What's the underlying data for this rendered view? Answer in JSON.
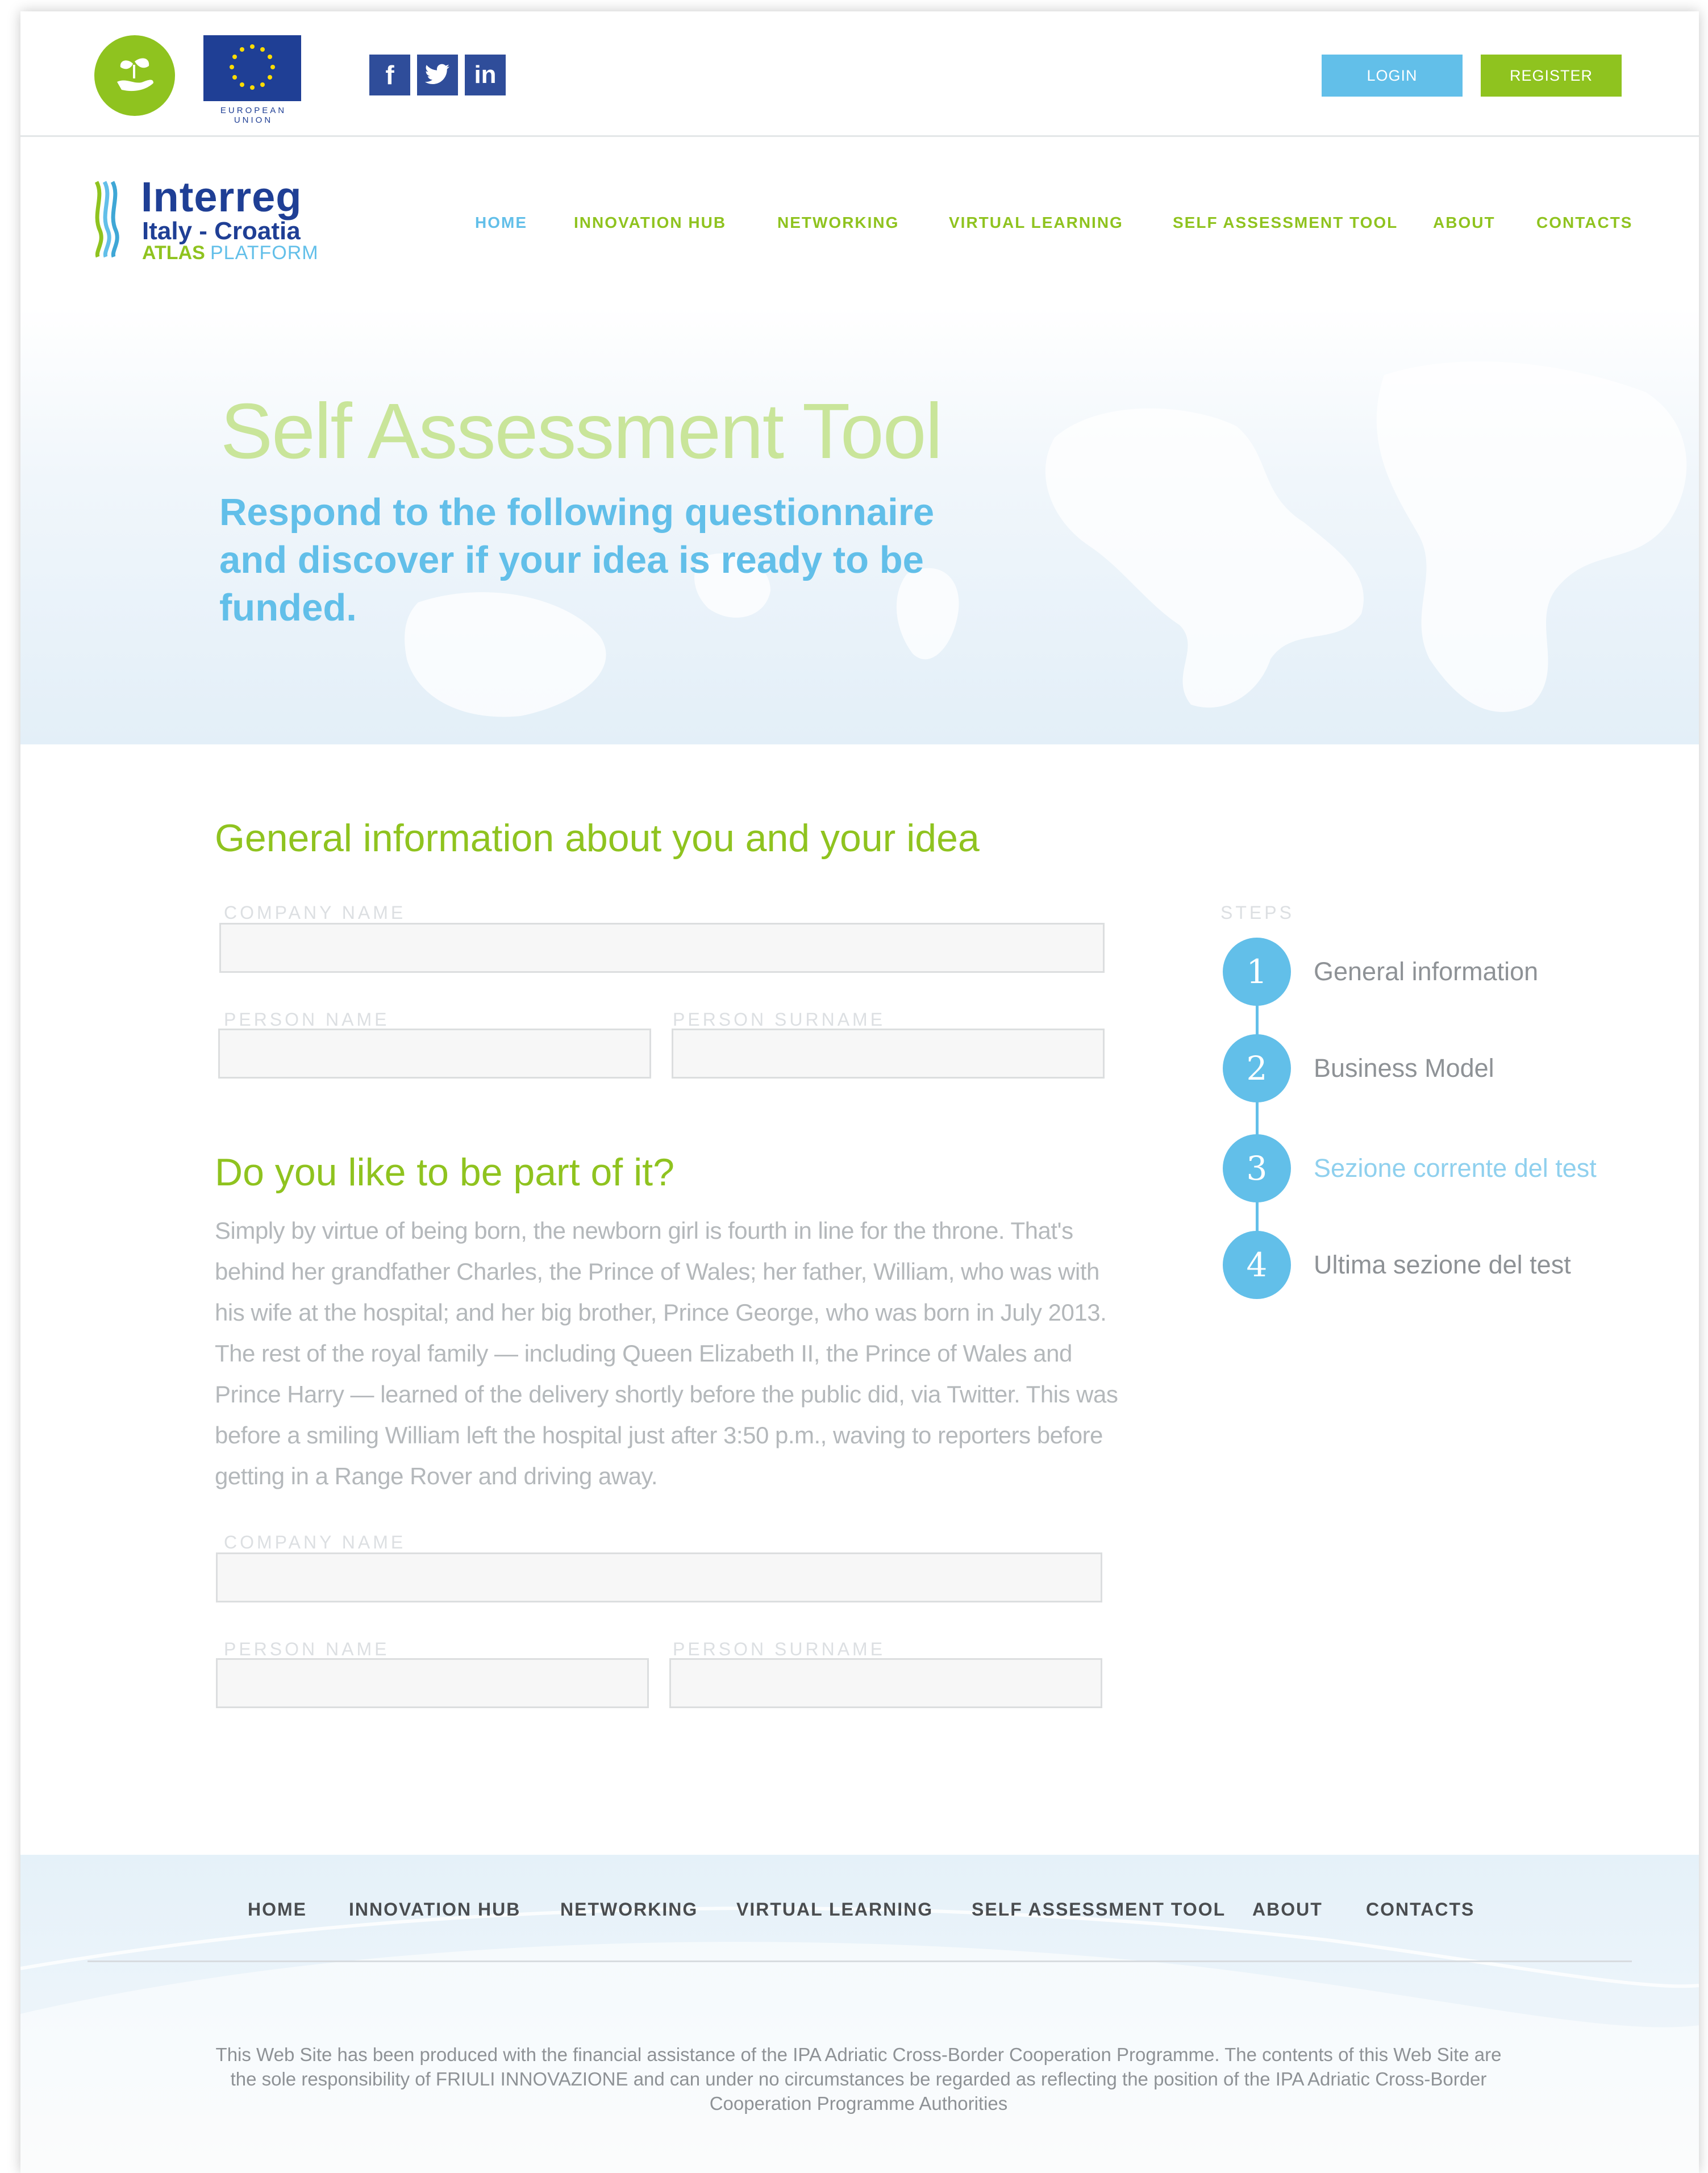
{
  "top_bar": {
    "eu_caption": "EUROPEAN UNION",
    "social": [
      {
        "icon": "facebook-icon",
        "glyph": "f"
      },
      {
        "icon": "twitter-icon",
        "glyph": "t"
      },
      {
        "icon": "linkedin-icon",
        "glyph": "in"
      }
    ],
    "login_label": "LOGIN",
    "register_label": "REGISTER"
  },
  "logo": {
    "line1": "Interreg",
    "line2": "Italy - Croatia",
    "line3a": "ATLAS",
    "line3b": "PLATFORM"
  },
  "nav": {
    "items": [
      "HOME",
      "INNOVATION HUB",
      "NETWORKING",
      "VIRTUAL LEARNING",
      "SELF ASSESSMENT TOOL",
      "ABOUT",
      "CONTACTS"
    ],
    "active": "HOME"
  },
  "hero": {
    "title": "Self Assessment Tool",
    "subtitle": "Respond to the following questionnaire and discover if your idea is ready to be funded."
  },
  "form": {
    "section1_title": "General information about you and your idea",
    "section2_title": "Do you like to be part of it?",
    "labels": {
      "company": "COMPANY NAME",
      "person_name": "PERSON NAME",
      "person_surname": "PERSON SURNAME"
    },
    "paragraph": "Simply by virtue of being born, the newborn girl is fourth in line for the throne. That's behind her grandfather Charles, the Prince of Wales; her father, William, who was with his wife at the hospital; and her big brother, Prince George, who was born in July 2013. The rest of the royal family — including Queen Elizabeth II, the Prince of Wales and Prince Harry — learned of the delivery shortly before the public did, via Twitter. This was before a smiling William left the hospital just after 3:50 p.m., waving to reporters before getting in a Range Rover and driving away."
  },
  "steps": {
    "label": "STEPS",
    "items": [
      {
        "number": "1",
        "label": "General information"
      },
      {
        "number": "2",
        "label": "Business Model"
      },
      {
        "number": "3",
        "label": "Sezione corrente del test"
      },
      {
        "number": "4",
        "label": "Ultima sezione del test"
      }
    ],
    "current_index": 2
  },
  "footer": {
    "nav": [
      "HOME",
      "INNOVATION HUB",
      "NETWORKING",
      "VIRTUAL LEARNING",
      "SELF ASSESSMENT TOOL",
      "ABOUT",
      "CONTACTS"
    ],
    "disclaimer": "This Web Site has been produced with the financial assistance of the IPA Adriatic Cross-Border Cooperation Programme. The contents of this Web Site are the sole responsibility of FRIULI INNOVAZIONE  and can under no circumstances be regarded as reflecting the position of the IPA Adriatic Cross-Border Cooperation Programme Authorities"
  },
  "colors": {
    "brand_green": "#8fc31f",
    "brand_blue": "#62bfe9",
    "eu_blue": "#1f3f95",
    "social_blue": "#2f4d9a",
    "current_step_text": "#8fd0ee"
  }
}
